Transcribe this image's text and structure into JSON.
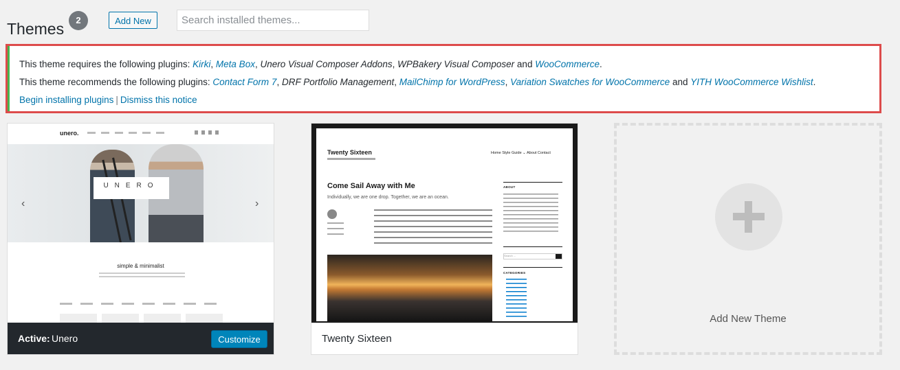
{
  "header": {
    "title": "Themes",
    "count": "2",
    "add_new_label": "Add New",
    "search_placeholder": "Search installed themes..."
  },
  "notice": {
    "required_intro": "This theme requires the following plugins:",
    "required": {
      "kirki": "Kirki",
      "meta_box": "Meta Box",
      "unero_addons": "Unero Visual Composer Addons",
      "wpbakery": "WPBakery Visual Composer",
      "and": "and",
      "woocommerce": "WooCommerce"
    },
    "recommended_intro": "This theme recommends the following plugins:",
    "recommended": {
      "contact_form_7": "Contact Form 7",
      "drf_portfolio": "DRF Portfolio Management",
      "mailchimp": "MailChimp for WordPress",
      "variation_swatches": "Variation Swatches for WooCommerce",
      "and": "and",
      "yith_wishlist": "YITH WooCommerce Wishlist"
    },
    "begin_installing": "Begin installing plugins",
    "separator": "|",
    "dismiss": "Dismiss this notice",
    "accent_color": "#46b450",
    "highlight_border_color": "#dd4b4b"
  },
  "themes": {
    "active": {
      "active_label": "Active:",
      "name": "Unero",
      "customize_label": "Customize",
      "screenshot": {
        "logo": "unero.",
        "brand": "UNERO",
        "tagline": "simple & minimalist",
        "icons": [
          "chevron-left-icon",
          "chevron-right-icon"
        ]
      }
    },
    "second": {
      "name": "Twenty Sixteen",
      "screenshot": {
        "site_title": "Twenty Sixteen",
        "nav": "Home   Style Guide ⌄   About   Contact",
        "post_title": "Come Sail Away with Me",
        "excerpt": "Individually, we are one drop. Together, we are an ocean.",
        "sidebar_about": "ABOUT",
        "search_placeholder": "Search ...",
        "sidebar_categories": "CATEGORIES"
      }
    },
    "add_new_label": "Add New Theme"
  },
  "colors": {
    "primary_button": "#0085ba",
    "link": "#0073aa",
    "active_footer": "#23282d"
  }
}
